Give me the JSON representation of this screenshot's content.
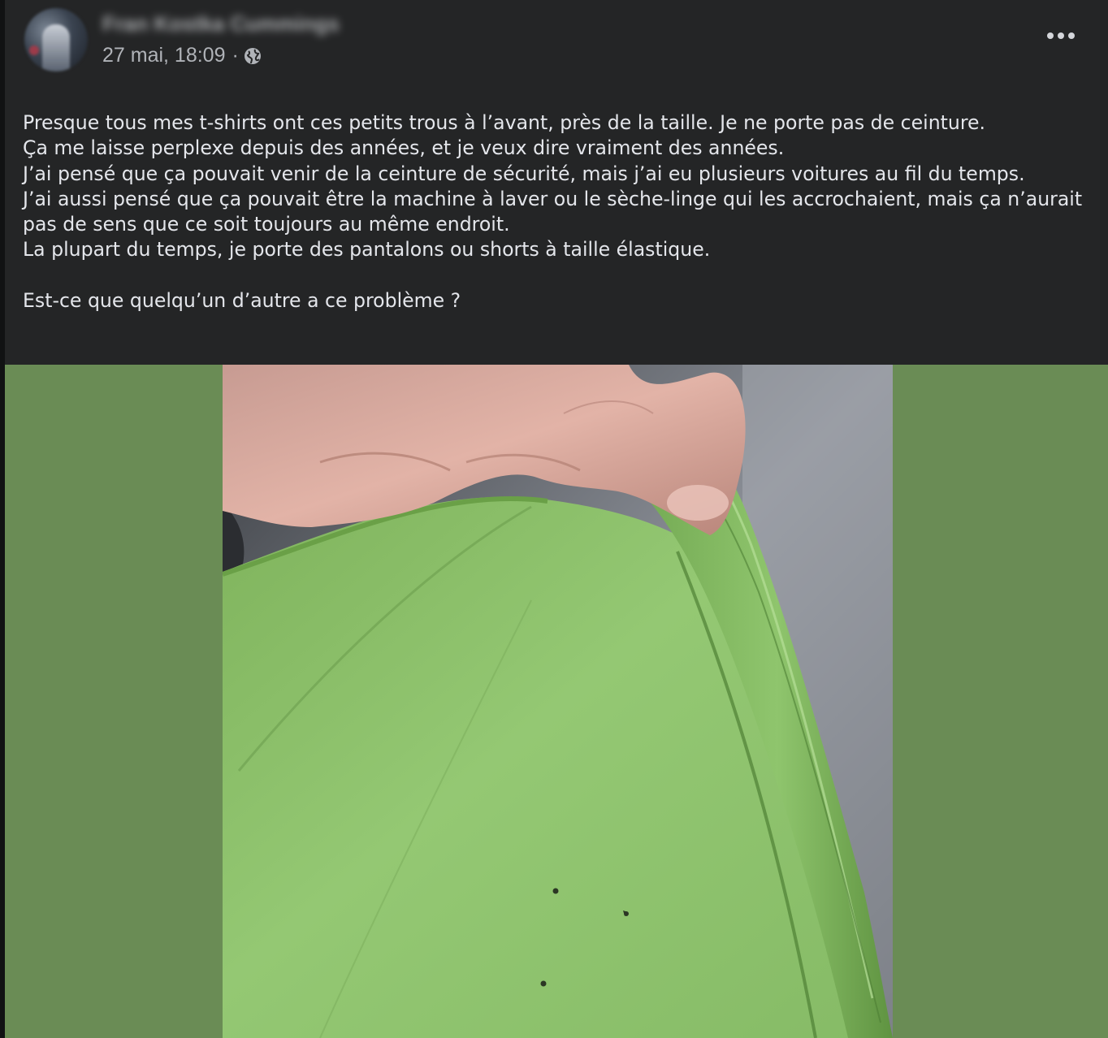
{
  "post": {
    "author_name": "Fran Kostka Cummings",
    "timestamp": "27 mai, 18:09",
    "separator": "·",
    "privacy_icon": "globe-icon",
    "more_icon": "more-options-icon",
    "body": {
      "paragraphs": [
        "Presque tous mes t-shirts ont ces petits trous à l’avant, près de la taille. Je ne porte pas de ceinture.",
        "Ça me laisse perplexe depuis des années, et je veux dire vraiment des années.",
        "J’ai pensé que ça pouvait venir de la ceinture de sécurité, mais j’ai eu plusieurs voitures au fil du temps.",
        "J’ai aussi pensé que ça pouvait être la machine à laver ou le sèche-linge qui les accrochaient, mais ça n’aurait pas de sens que ce soit toujours au même endroit.",
        "La plupart du temps, je porte des pantalons ou shorts à taille élastique.",
        "Est-ce que quelqu’un d’autre a ce problème ?"
      ]
    },
    "photo": {
      "subject": "hand pulling up green t-shirt showing small holes near the waist"
    },
    "colors": {
      "card_bg": "#242526",
      "text_primary": "#e4e6eb",
      "text_secondary": "#b0b3b8",
      "media_bg": "#6a8c55",
      "shirt_green": "#8cc06a"
    }
  }
}
